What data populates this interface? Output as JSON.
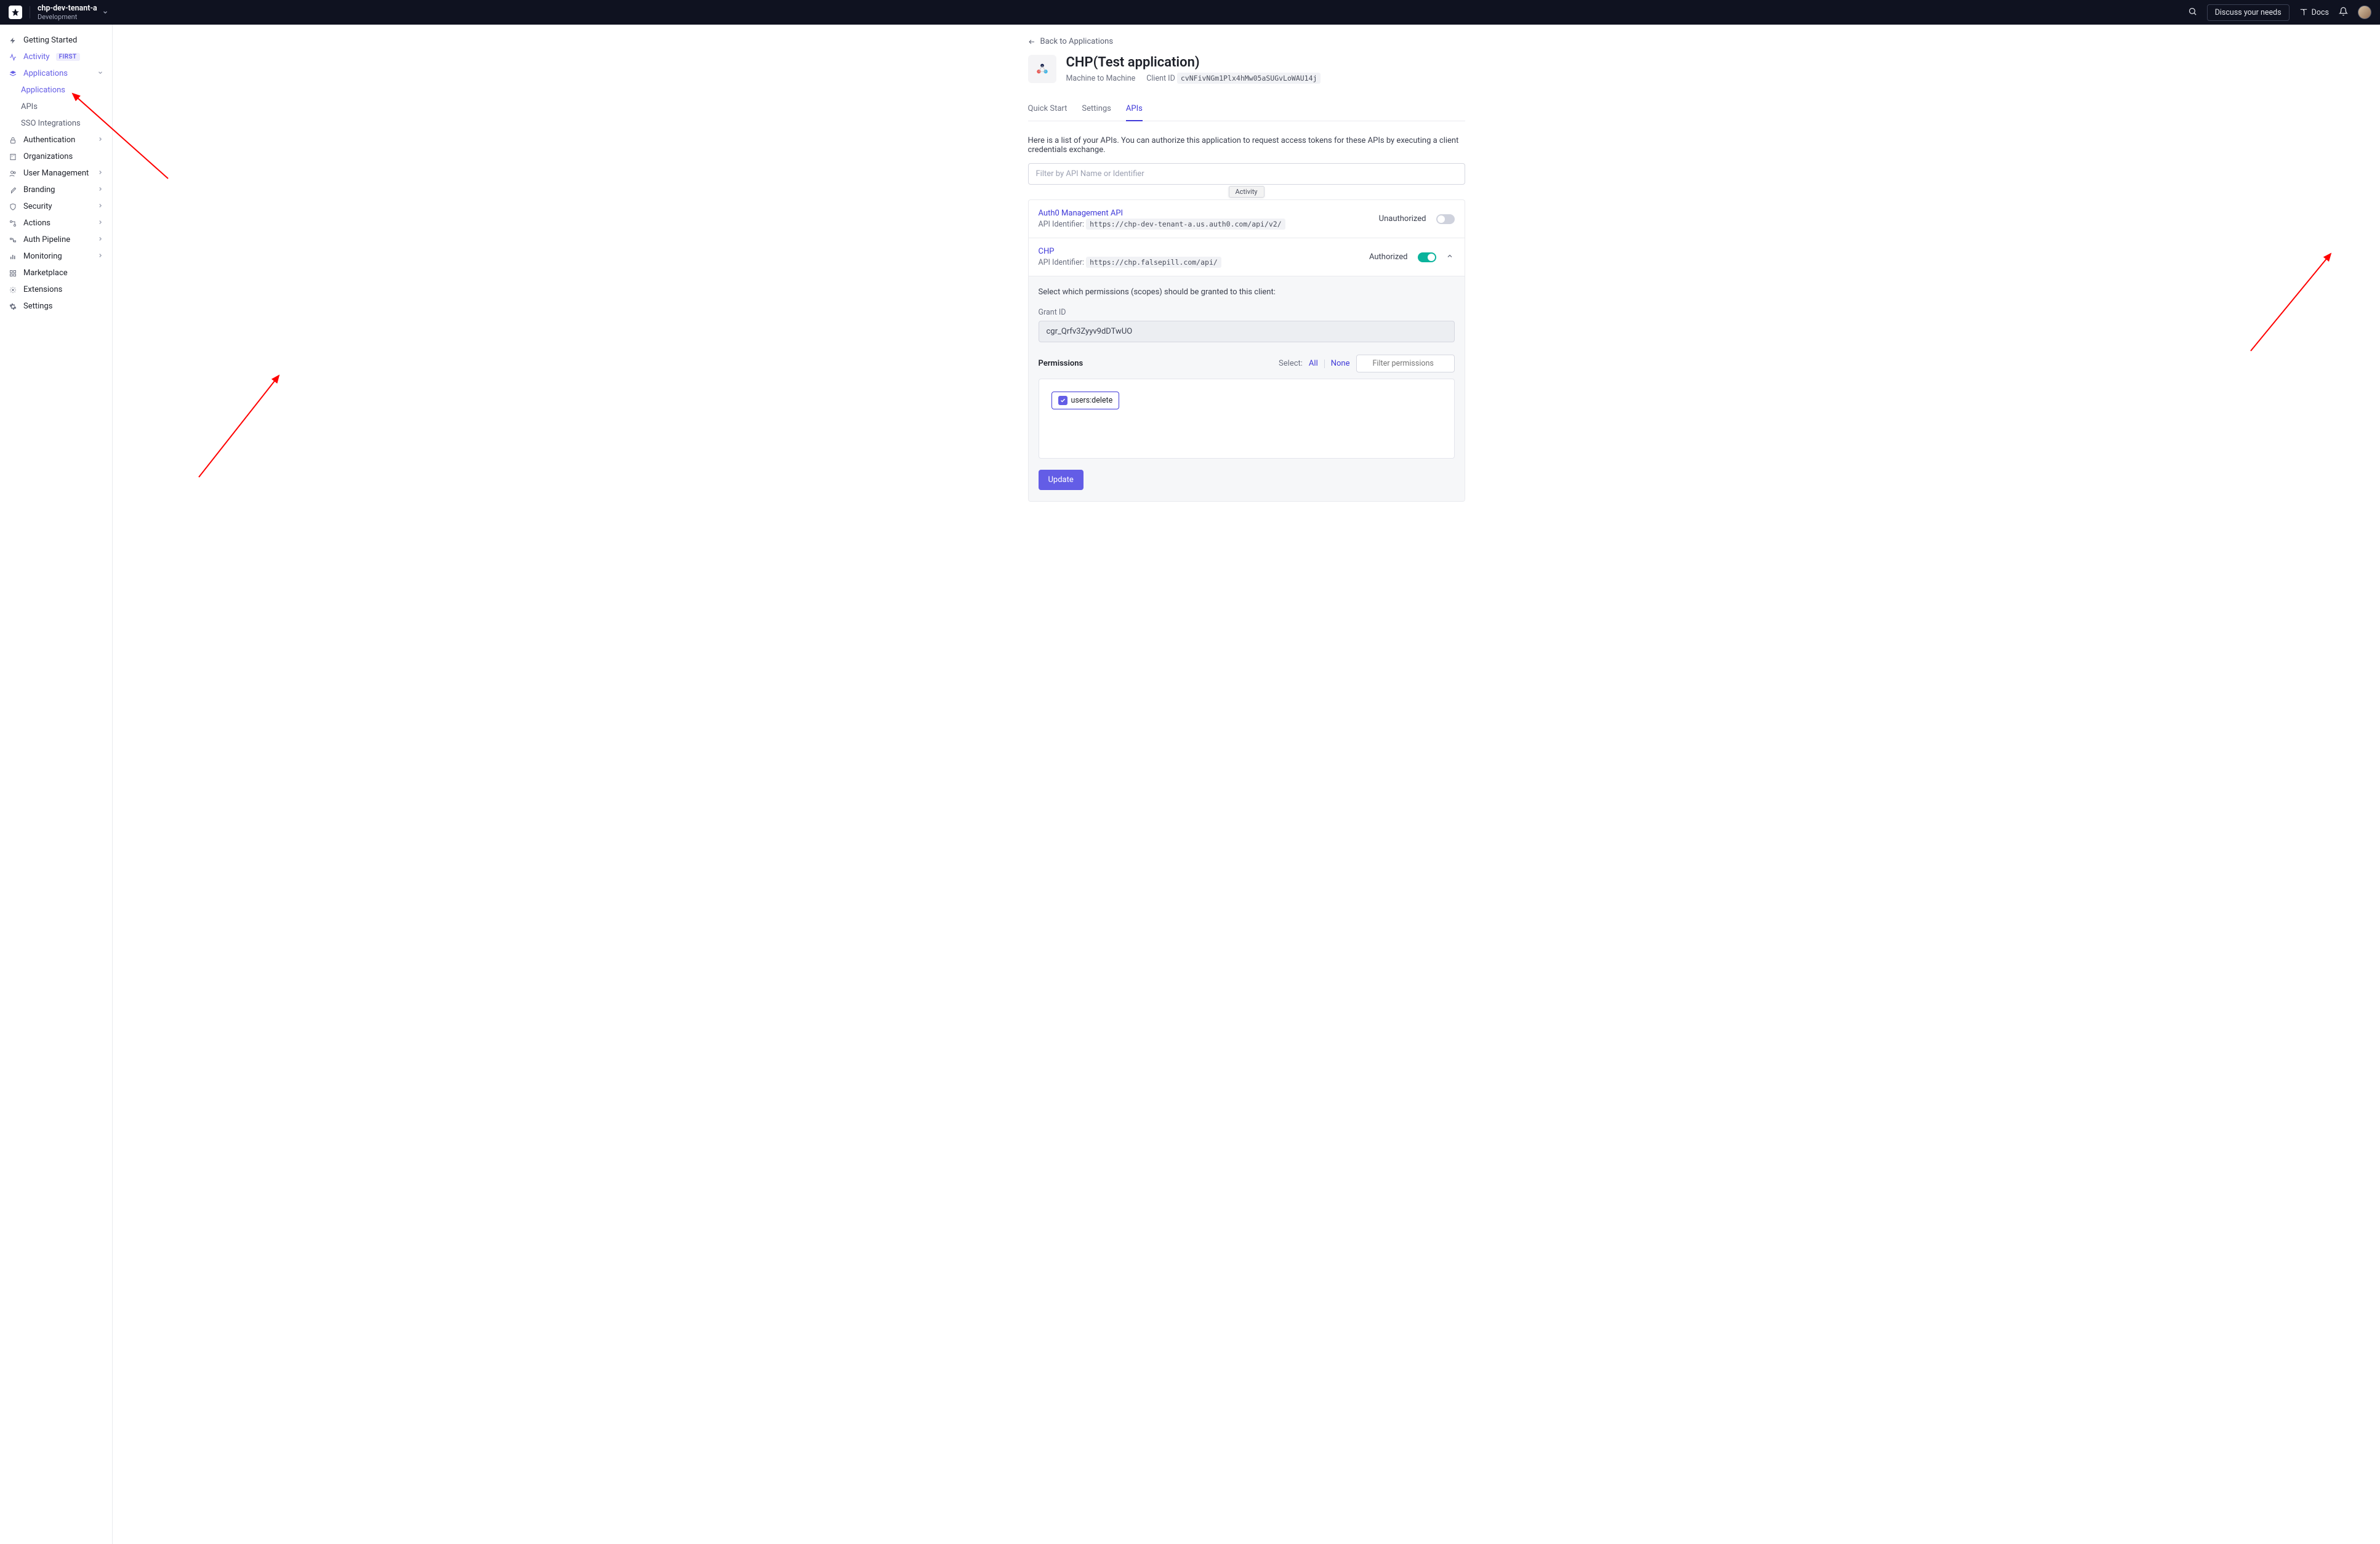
{
  "topbar": {
    "tenant_name": "chp-dev-tenant-a",
    "tenant_env": "Development",
    "discuss": "Discuss your needs",
    "docs": "Docs"
  },
  "sidebar": {
    "getting_started": "Getting Started",
    "activity": "Activity",
    "activity_badge": "FIRST",
    "applications": "Applications",
    "applications_sub": "Applications",
    "apis": "APIs",
    "sso": "SSO Integrations",
    "authentication": "Authentication",
    "organizations": "Organizations",
    "user_mgmt": "User Management",
    "branding": "Branding",
    "security": "Security",
    "actions": "Actions",
    "auth_pipeline": "Auth Pipeline",
    "monitoring": "Monitoring",
    "marketplace": "Marketplace",
    "extensions": "Extensions",
    "settings": "Settings"
  },
  "back_label": "Back to Applications",
  "app": {
    "name": "CHP(Test application)",
    "type": "Machine to Machine",
    "client_id_label": "Client ID",
    "client_id": "cvNFivNGm1Plx4hMw05aSUGvLoWAU14j"
  },
  "tabs": {
    "quick_start": "Quick Start",
    "settings": "Settings",
    "apis": "APIs"
  },
  "desc": "Here is a list of your APIs. You can authorize this application to request access tokens for these APIs by executing a client credentials exchange.",
  "filter_placeholder": "Filter by API Name or Identifier",
  "tooltip_text": "Activity",
  "apis": {
    "mgmt": {
      "name": "Auth0 Management API",
      "identifier_label": "API Identifier:",
      "identifier": "https://chp-dev-tenant-a.us.auth0.com/api/v2/",
      "auth_label": "Unauthorized"
    },
    "chp": {
      "name": "CHP",
      "identifier_label": "API Identifier:",
      "identifier": "https://chp.falsepill.com/api/",
      "auth_label": "Authorized"
    }
  },
  "expanded": {
    "scope_desc": "Select which permissions (scopes) should be granted to this client:",
    "grant_label": "Grant ID",
    "grant_id": "cgr_Qrfv3Zyyv9dDTwUO",
    "permissions_title": "Permissions",
    "select_label": "Select:",
    "all": "All",
    "none": "None",
    "filter_perm_placeholder": "Filter permissions",
    "perm1": "users:delete",
    "update": "Update"
  }
}
